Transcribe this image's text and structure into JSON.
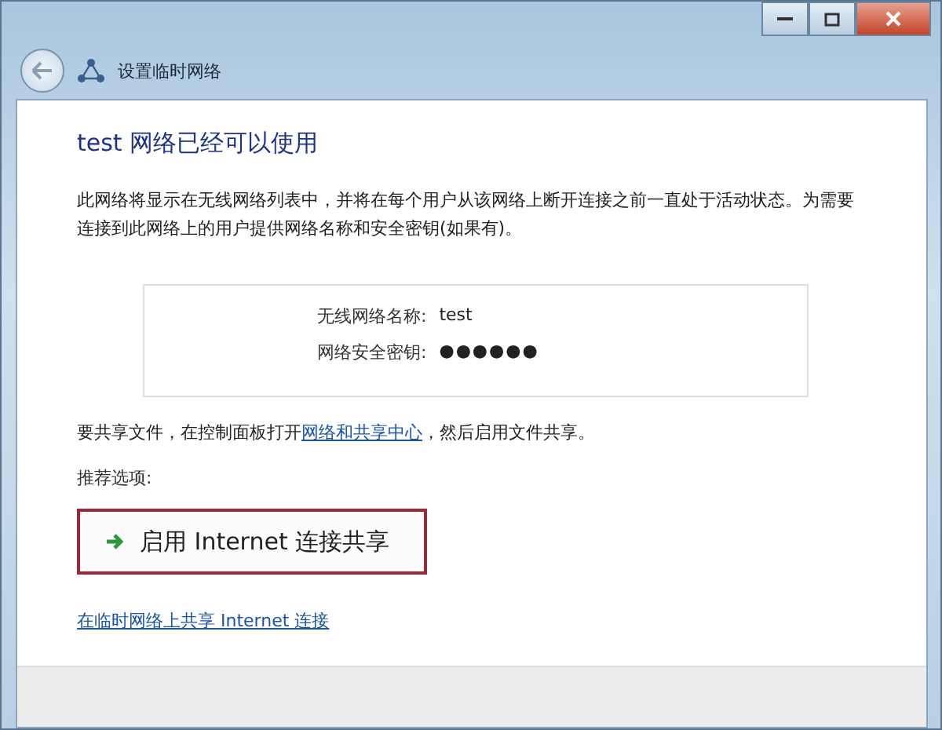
{
  "window": {
    "title": "设置临时网络"
  },
  "heading": "test 网络已经可以使用",
  "description": "此网络将显示在无线网络列表中，并将在每个用户从该网络上断开连接之前一直处于活动状态。为需要连接到此网络上的用户提供网络名称和安全密钥(如果有)。",
  "network_info": [
    {
      "label": "无线网络名称:",
      "value": "test",
      "kind": "text"
    },
    {
      "label": "网络安全密钥:",
      "value": "●●●●●●",
      "kind": "secret"
    }
  ],
  "share_files": {
    "before": "要共享文件，在控制面板打开",
    "link": "网络和共享中心",
    "after": "，然后启用文件共享。"
  },
  "recommended_label": "推荐选项:",
  "command": {
    "label": "启用 Internet 连接共享",
    "highlighted": true
  },
  "share_link": "在临时网络上共享 Internet 连接"
}
